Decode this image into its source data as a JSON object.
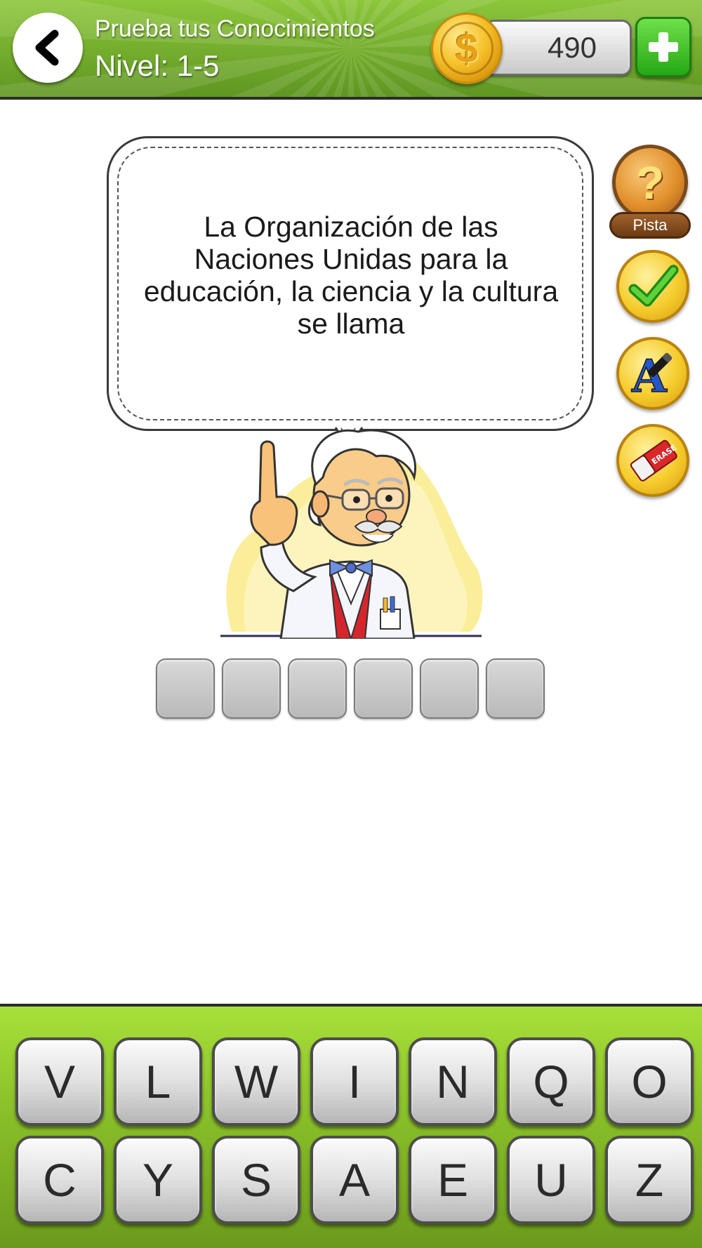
{
  "header": {
    "title": "Prueba tus Conocimientos",
    "level": "Nivel: 1-5",
    "coins": "490"
  },
  "question": {
    "text": "La Organización de las Naciones Unidas para la educación, la ciencia y la cultura se llama"
  },
  "side_buttons": {
    "hint_label": "Pista",
    "hint_icon": "question-mark-icon",
    "check_icon": "check-icon",
    "reveal_letter_icon": "letter-pen-icon",
    "erase_icon": "eraser-icon",
    "eraser_text": "ERASE"
  },
  "answer": {
    "slots": [
      "",
      "",
      "",
      "",
      "",
      ""
    ]
  },
  "keyboard": {
    "row1": [
      "V",
      "L",
      "W",
      "I",
      "N",
      "Q",
      "O"
    ],
    "row2": [
      "C",
      "Y",
      "S",
      "A",
      "E",
      "U",
      "Z"
    ]
  },
  "colors": {
    "header_green": "#7cb82f",
    "keyboard_green": "#99d030",
    "coin_gold": "#f6c12a",
    "plus_green": "#34b81e"
  }
}
